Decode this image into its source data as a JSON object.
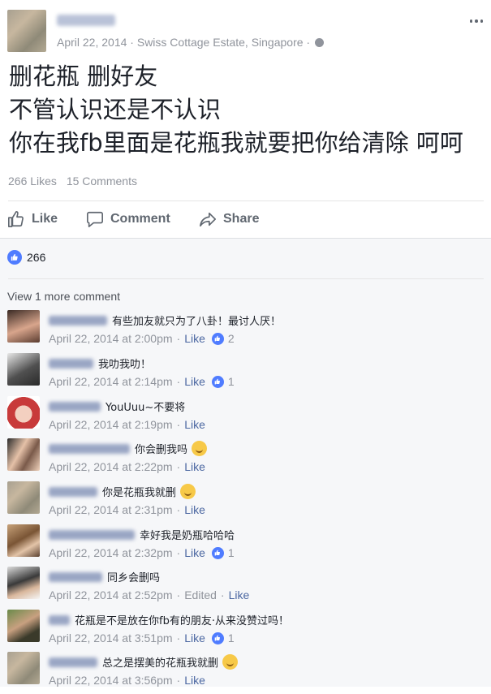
{
  "post": {
    "date": "April 22, 2014",
    "location": "Swiss Cottage Estate, Singapore",
    "separator": "·",
    "text_lines": [
      "删花瓶 删好友",
      "不管认识还是不认识",
      "你在我fb里面是花瓶我就要把你给清除 呵呵"
    ],
    "likes_text": "266 Likes",
    "comments_text": "15 Comments"
  },
  "actions": {
    "like": "Like",
    "comment": "Comment",
    "share": "Share"
  },
  "reactions": {
    "count": "266"
  },
  "view_more": "View 1 more comment",
  "comments": [
    {
      "text": "有些加友就只为了八卦！最讨人厌！",
      "time": "April 22, 2014 at 2:00pm",
      "like": "Like",
      "count": "2"
    },
    {
      "text": "我叻我叻！",
      "time": "April 22, 2014 at 2:14pm",
      "like": "Like",
      "count": "1"
    },
    {
      "text": "YouUuu~不要将",
      "time": "April 22, 2014 at 2:19pm",
      "like": "Like",
      "count": ""
    },
    {
      "text": "你会删我吗",
      "time": "April 22, 2014 at 2:22pm",
      "like": "Like",
      "count": ""
    },
    {
      "text": "你是花瓶我就删",
      "time": "April 22, 2014 at 2:31pm",
      "like": "Like",
      "count": ""
    },
    {
      "text": "幸好我是奶瓶哈哈哈",
      "time": "April 22, 2014 at 2:32pm",
      "like": "Like",
      "count": "1"
    },
    {
      "text": "同乡会删吗",
      "time": "April 22, 2014 at 2:52pm",
      "edited": "Edited",
      "like": "Like",
      "count": ""
    },
    {
      "text": "花瓶是不是放在你fb有的朋友·从来没赞过吗！",
      "time": "April 22, 2014 at 3:51pm",
      "like": "Like",
      "count": "1"
    },
    {
      "text": "总之是摆美的花瓶我就删",
      "time": "April 22, 2014 at 3:56pm",
      "like": "Like",
      "count": ""
    }
  ],
  "colors": {
    "link": "#4b67a1",
    "like_blue": "#4f7cff",
    "muted": "#90949c",
    "comments_bg": "#f6f7f9"
  }
}
